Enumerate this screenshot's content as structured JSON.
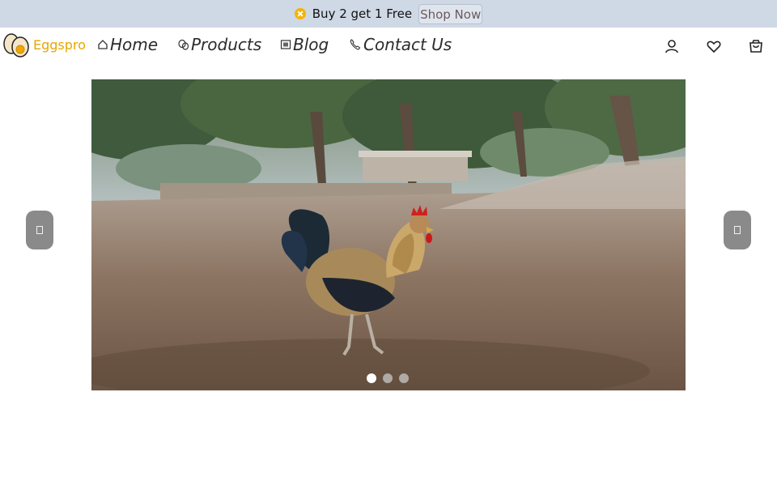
{
  "promo": {
    "text": "Buy 2 get 1 Free",
    "shop_label": "Shop Now",
    "icon": "close-circle-icon"
  },
  "brand": {
    "name": "Eggspro",
    "icon": "eggs-logo-icon",
    "color": "#e6a700"
  },
  "nav": {
    "items": [
      {
        "label": "Home",
        "icon": "home-icon"
      },
      {
        "label": "Products",
        "icon": "egg-icon"
      },
      {
        "label": "Blog",
        "icon": "blog-icon"
      },
      {
        "label": "Contact Us",
        "icon": "phone-icon"
      }
    ]
  },
  "actions": {
    "account": "user-icon",
    "wishlist": "heart-icon",
    "cart": "shopping-bag-icon"
  },
  "carousel": {
    "slide_count": 3,
    "active_index": 0,
    "current_slide": "Rooster standing on a dirt yard with trees in the background",
    "prev_icon": "chevron-left-icon",
    "next_icon": "chevron-right-icon"
  },
  "colors": {
    "promo_bg": "#cfd8e5",
    "arrow_bg": "#8a8a8a"
  }
}
